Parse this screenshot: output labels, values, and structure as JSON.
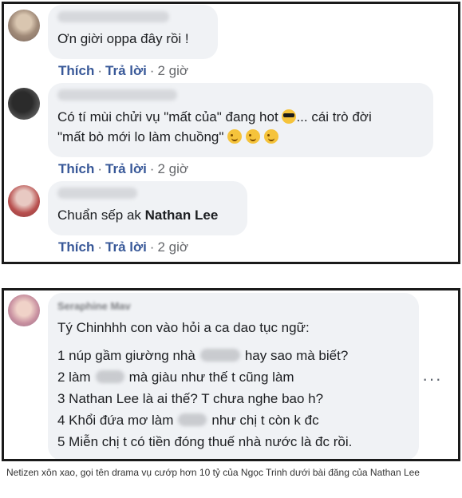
{
  "top_panel": {
    "comments": [
      {
        "text": "Ơn giời oppa đây rồi !",
        "actions": {
          "like": "Thích",
          "reply": "Trả lời",
          "time": "2 giờ"
        }
      },
      {
        "line1": "Có tí mùi chửi vụ \"mất của\" đang hot",
        "line1_after": "... cái trò đời",
        "line2": "\"mất bò mới lo làm chuồng\"",
        "actions": {
          "like": "Thích",
          "reply": "Trả lời",
          "time": "2 giờ"
        }
      },
      {
        "text": "Chuẩn sếp ak",
        "mention": "Nathan Lee",
        "actions": {
          "like": "Thích",
          "reply": "Trả lời",
          "time": "2 giờ"
        }
      }
    ],
    "separator": "·"
  },
  "bottom_panel": {
    "author": "Seraphine Mav",
    "intro": "Tý Chinhhh con vào hỏi a ca dao tục ngữ:",
    "lines": [
      {
        "before": "1 núp gầm giường nhà",
        "after": "hay sao mà biết?"
      },
      {
        "before": "2 làm",
        "after": "mà giàu như thế t cũng làm"
      },
      {
        "before": "3 Nathan Lee là ai thế? T chưa nghe bao h?",
        "after": ""
      },
      {
        "before": "4 Khổi đứa mơ làm",
        "after": "như chị t còn k đc"
      },
      {
        "before": "5 Miễn chị t có tiền đóng thuế nhà nước là đc rồi.",
        "after": ""
      }
    ],
    "ellipsis": "...",
    "more_label": "···"
  },
  "caption": "Netizen xôn xao, gọi tên drama vụ cướp hơn 10 tỷ của Ngọc Trinh dưới bài đăng của Nathan Lee",
  "colors": {
    "bubble": "#f0f2f5",
    "link": "#385898",
    "meta": "#65676b",
    "text": "#1c1e21",
    "border": "#1a1a1a"
  }
}
